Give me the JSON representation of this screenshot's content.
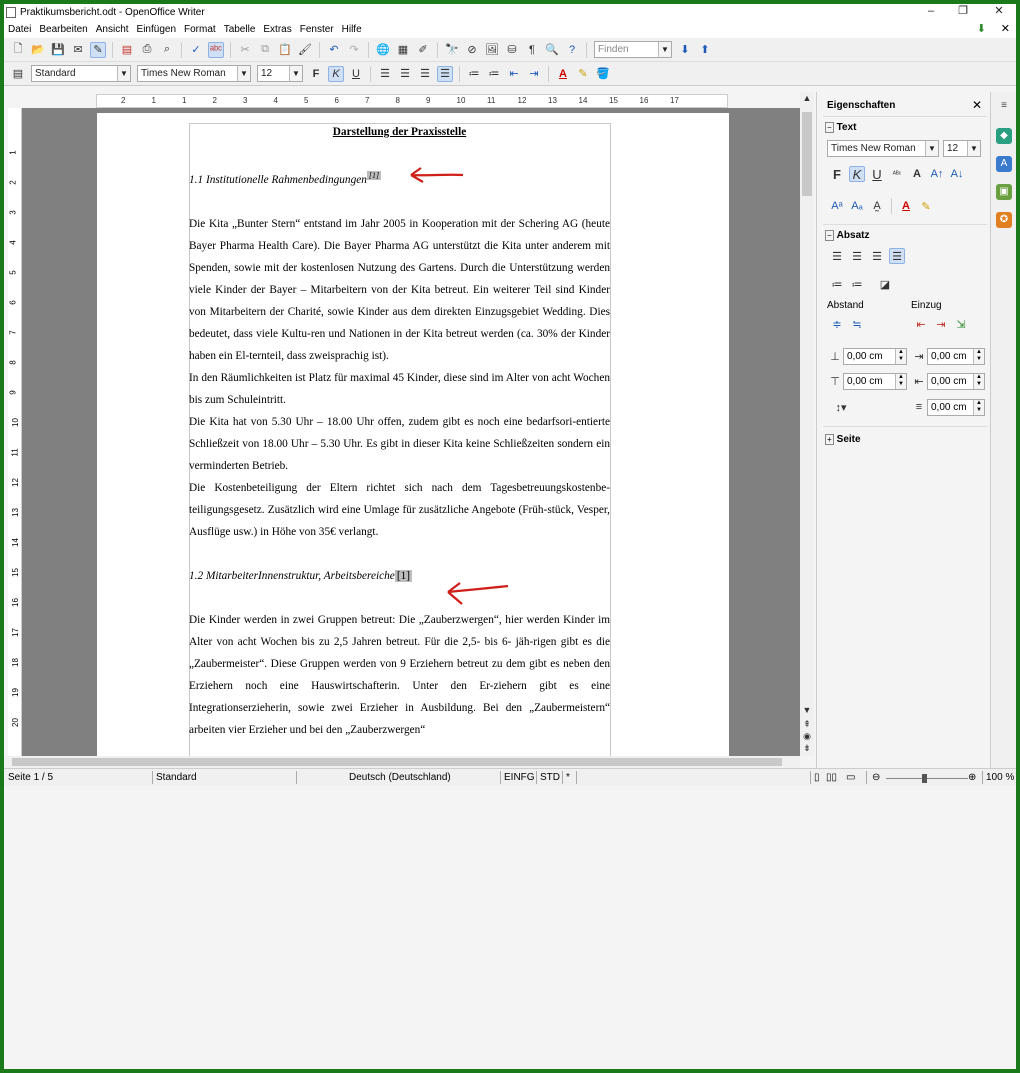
{
  "window": {
    "title": "Praktikumsbericht.odt - OpenOffice Writer",
    "minimize": "–",
    "restore": "❐",
    "close": "✕"
  },
  "menu": [
    "Datei",
    "Bearbeiten",
    "Ansicht",
    "Einfügen",
    "Format",
    "Tabelle",
    "Extras",
    "Fenster",
    "Hilfe"
  ],
  "menu_close": "✕",
  "toolbar": {
    "find_placeholder": "Finden",
    "style": "Standard",
    "font": "Times New Roman",
    "size": "12"
  },
  "format_buttons": {
    "bold": "F",
    "italic": "K",
    "underline": "U"
  },
  "ruler": [
    "2",
    "1",
    "1",
    "2",
    "3",
    "4",
    "5",
    "6",
    "7",
    "8",
    "9",
    "10",
    "11",
    "12",
    "13",
    "14",
    "15",
    "16",
    "17"
  ],
  "vruler": [
    "1",
    "2",
    "3",
    "4",
    "5",
    "6",
    "7",
    "8",
    "9",
    "10",
    "11",
    "12",
    "13",
    "14",
    "15",
    "16",
    "17",
    "18",
    "19",
    "20"
  ],
  "document": {
    "heading": "Darstellung der Praxisstelle",
    "sub1": "1.1 Institutionelle Rahmenbedingungen",
    "sub1_fn": "[1]",
    "paras1": [
      "Die Kita „Bunter Stern“ entstand im Jahr 2005 in Kooperation mit der Schering AG (heute Bayer Pharma Health Care). Die Bayer Pharma AG unterstützt die Kita unter anderem mit Spenden, sowie mit der kostenlosen Nutzung des Gartens. Durch die Unterstützung werden viele Kinder der Bayer – Mitarbeitern von der Kita betreut. Ein weiterer Teil sind Kinder von Mitarbeitern der Charité, sowie Kinder aus dem direkten Einzugsgebiet Wedding. Dies bedeutet, dass viele Kultu-ren und Nationen in der Kita betreut werden (ca. 30% der Kinder haben ein El-ternteil, dass zweisprachig ist).",
      "In den Räumlichkeiten ist Platz für maximal 45 Kinder, diese sind im Alter von acht Wochen bis zum Schuleintritt.",
      "Die Kita hat von 5.30 Uhr – 18.00 Uhr offen, zudem gibt es noch eine bedarfsori-entierte Schließzeit von 18.00 Uhr – 5.30 Uhr. Es gibt in dieser Kita keine Schließzeiten sondern ein verminderten Betrieb.",
      "Die Kostenbeteiligung der Eltern richtet sich nach dem Tagesbetreuungskostenbe-teiligungsgesetz. Zusätzlich wird eine Umlage für zusätzliche Angebote (Früh-stück, Vesper, Ausflüge usw.) in Höhe von 35€ verlangt."
    ],
    "sub2": "1.2 MitarbeiterInnenstruktur, Arbeitsbereiche",
    "sub2_fn": "[1]",
    "paras2": [
      "Die Kinder werden in zwei Gruppen betreut: Die „Zauberzwergen“, hier werden Kinder im Alter von acht Wochen bis zu 2,5 Jahren betreut. Für die 2,5- bis 6- jäh-rigen gibt es die „Zaubermeister“. Diese Gruppen werden von 9 Erziehern betreut zu dem gibt es neben den Erziehern noch eine Hauswirtschafterin. Unter den Er-ziehern gibt es eine Integrationserzieherin, sowie zwei Erzieher in Ausbildung. Bei den „Zaubermeistern“ arbeiten vier Erzieher und bei den „Zauberzwergen“"
    ]
  },
  "status": {
    "page": "Seite 1 / 5",
    "style": "Standard",
    "language": "Deutsch (Deutschland)",
    "insert": "EINFG",
    "std": "STD",
    "modified": "*",
    "zoom": "100 %"
  },
  "sidebar": {
    "title": "Eigenschaften",
    "close": "✕",
    "text_section": "Text",
    "font": "Times New Roman",
    "size": "12",
    "para_section": "Absatz",
    "spacing_label": "Abstand",
    "indent_label": "Einzug",
    "spin_values": [
      "0,00 cm",
      "0,00 cm",
      "0,00 cm",
      "0,00 cm",
      "0,00 cm"
    ],
    "page_section": "Seite",
    "fmt": {
      "bold": "F",
      "italic": "K",
      "underline": "U"
    }
  },
  "colors": {
    "accent_green": "#1a7a1a",
    "annotation_red": "#d0201a"
  }
}
